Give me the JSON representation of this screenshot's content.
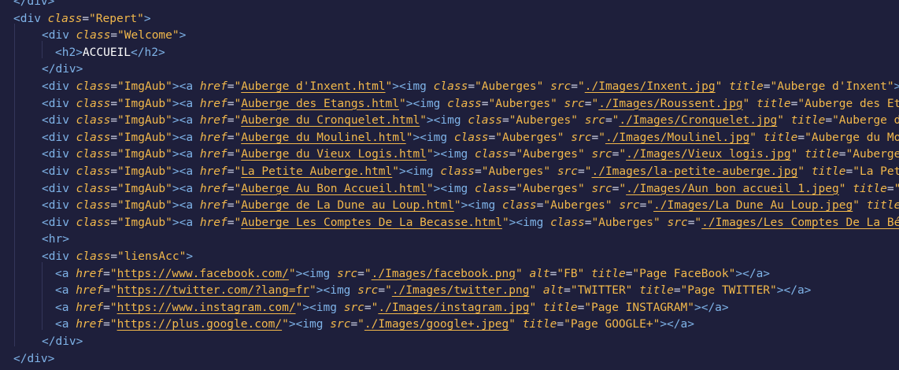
{
  "editor": {
    "colors": {
      "background": "#1e1f3b",
      "tag": "#7fb3e8",
      "attribute": "#f2b84b",
      "string": "#f2b84b",
      "text": "#ffffff"
    },
    "lines": [
      [
        [
          "t",
          "</div>"
        ]
      ],
      [
        [
          "t",
          "<div "
        ],
        [
          "a",
          "class"
        ],
        [
          "e",
          "="
        ],
        [
          "s",
          "\"Repert\""
        ],
        [
          "t",
          ">"
        ]
      ],
      [
        [
          "t",
          "<div "
        ],
        [
          "a",
          "class"
        ],
        [
          "e",
          "="
        ],
        [
          "s",
          "\"Welcome\""
        ],
        [
          "t",
          ">"
        ]
      ],
      [
        [
          "t",
          "<h2>"
        ],
        [
          "x",
          "ACCUEIL"
        ],
        [
          "t",
          "</h2>"
        ]
      ],
      [
        [
          "t",
          "</div>"
        ]
      ],
      [
        [
          "t",
          "<div "
        ],
        [
          "a",
          "class"
        ],
        [
          "e",
          "="
        ],
        [
          "s",
          "\"ImgAub\""
        ],
        [
          "t",
          "><a "
        ],
        [
          "a",
          "href"
        ],
        [
          "e",
          "="
        ],
        [
          "s",
          "\""
        ],
        [
          "l",
          "Auberge d'Inxent.html"
        ],
        [
          "s",
          "\""
        ],
        [
          "t",
          "><img "
        ],
        [
          "a",
          "class"
        ],
        [
          "e",
          "="
        ],
        [
          "s",
          "\"Auberges\" "
        ],
        [
          "a",
          "src"
        ],
        [
          "e",
          "="
        ],
        [
          "s",
          "\""
        ],
        [
          "l",
          "./Images/Inxent.jpg"
        ],
        [
          "s",
          "\" "
        ],
        [
          "a",
          "title"
        ],
        [
          "e",
          "="
        ],
        [
          "s",
          "\"Auberge d'Inxent\""
        ],
        [
          "t",
          "><"
        ]
      ],
      [
        [
          "t",
          "<div "
        ],
        [
          "a",
          "class"
        ],
        [
          "e",
          "="
        ],
        [
          "s",
          "\"ImgAub\""
        ],
        [
          "t",
          "><a "
        ],
        [
          "a",
          "href"
        ],
        [
          "e",
          "="
        ],
        [
          "s",
          "\""
        ],
        [
          "l",
          "Auberge des Etangs.html"
        ],
        [
          "s",
          "\""
        ],
        [
          "t",
          "><img "
        ],
        [
          "a",
          "class"
        ],
        [
          "e",
          "="
        ],
        [
          "s",
          "\"Auberges\" "
        ],
        [
          "a",
          "src"
        ],
        [
          "e",
          "="
        ],
        [
          "s",
          "\""
        ],
        [
          "l",
          "./Images/Roussent.jpg"
        ],
        [
          "s",
          "\" "
        ],
        [
          "a",
          "title"
        ],
        [
          "e",
          "="
        ],
        [
          "s",
          "\"Auberge des Etan"
        ]
      ],
      [
        [
          "t",
          "<div "
        ],
        [
          "a",
          "class"
        ],
        [
          "e",
          "="
        ],
        [
          "s",
          "\"ImgAub\""
        ],
        [
          "t",
          "><a "
        ],
        [
          "a",
          "href"
        ],
        [
          "e",
          "="
        ],
        [
          "s",
          "\""
        ],
        [
          "l",
          "Auberge du Cronquelet.html"
        ],
        [
          "s",
          "\""
        ],
        [
          "t",
          "><img "
        ],
        [
          "a",
          "class"
        ],
        [
          "e",
          "="
        ],
        [
          "s",
          "\"Auberges\" "
        ],
        [
          "a",
          "src"
        ],
        [
          "e",
          "="
        ],
        [
          "s",
          "\""
        ],
        [
          "l",
          "./Images/Cronquelet.jpg"
        ],
        [
          "s",
          "\" "
        ],
        [
          "a",
          "title"
        ],
        [
          "e",
          "="
        ],
        [
          "s",
          "\"Auberge du"
        ]
      ],
      [
        [
          "t",
          "<div "
        ],
        [
          "a",
          "class"
        ],
        [
          "e",
          "="
        ],
        [
          "s",
          "\"ImgAub\""
        ],
        [
          "t",
          "><a "
        ],
        [
          "a",
          "href"
        ],
        [
          "e",
          "="
        ],
        [
          "s",
          "\""
        ],
        [
          "l",
          "Auberge du Moulinel.html"
        ],
        [
          "s",
          "\""
        ],
        [
          "t",
          "><img "
        ],
        [
          "a",
          "class"
        ],
        [
          "e",
          "="
        ],
        [
          "s",
          "\"Auberges\" "
        ],
        [
          "a",
          "src"
        ],
        [
          "e",
          "="
        ],
        [
          "s",
          "\""
        ],
        [
          "l",
          "./Images/Moulinel.jpg"
        ],
        [
          "s",
          "\" "
        ],
        [
          "a",
          "title"
        ],
        [
          "e",
          "="
        ],
        [
          "s",
          "\"Auberge du Mou"
        ]
      ],
      [
        [
          "t",
          "<div "
        ],
        [
          "a",
          "class"
        ],
        [
          "e",
          "="
        ],
        [
          "s",
          "\"ImgAub\""
        ],
        [
          "t",
          "><a "
        ],
        [
          "a",
          "href"
        ],
        [
          "e",
          "="
        ],
        [
          "s",
          "\""
        ],
        [
          "l",
          "Auberge du Vieux Logis.html"
        ],
        [
          "s",
          "\""
        ],
        [
          "t",
          "><img "
        ],
        [
          "a",
          "class"
        ],
        [
          "e",
          "="
        ],
        [
          "s",
          "\"Auberges\" "
        ],
        [
          "a",
          "src"
        ],
        [
          "e",
          "="
        ],
        [
          "s",
          "\""
        ],
        [
          "l",
          "./Images/Vieux logis.jpg"
        ],
        [
          "s",
          "\" "
        ],
        [
          "a",
          "title"
        ],
        [
          "e",
          "="
        ],
        [
          "s",
          "\"Auberge "
        ]
      ],
      [
        [
          "t",
          "<div "
        ],
        [
          "a",
          "class"
        ],
        [
          "e",
          "="
        ],
        [
          "s",
          "\"ImgAub\""
        ],
        [
          "t",
          "><a "
        ],
        [
          "a",
          "href"
        ],
        [
          "e",
          "="
        ],
        [
          "s",
          "\""
        ],
        [
          "l",
          "La Petite Auberge.html"
        ],
        [
          "s",
          "\""
        ],
        [
          "t",
          "><img "
        ],
        [
          "a",
          "class"
        ],
        [
          "e",
          "="
        ],
        [
          "s",
          "\"Auberges\" "
        ],
        [
          "a",
          "src"
        ],
        [
          "e",
          "="
        ],
        [
          "s",
          "\""
        ],
        [
          "l",
          "./Images/la-petite-auberge.jpg"
        ],
        [
          "s",
          "\" "
        ],
        [
          "a",
          "title"
        ],
        [
          "e",
          "="
        ],
        [
          "s",
          "\"La Peti"
        ]
      ],
      [
        [
          "t",
          "<div "
        ],
        [
          "a",
          "class"
        ],
        [
          "e",
          "="
        ],
        [
          "s",
          "\"ImgAub\""
        ],
        [
          "t",
          "><a "
        ],
        [
          "a",
          "href"
        ],
        [
          "e",
          "="
        ],
        [
          "s",
          "\""
        ],
        [
          "l",
          "Auberge Au Bon Accueil.html"
        ],
        [
          "s",
          "\""
        ],
        [
          "t",
          "><img "
        ],
        [
          "a",
          "class"
        ],
        [
          "e",
          "="
        ],
        [
          "s",
          "\"Auberges\" "
        ],
        [
          "a",
          "src"
        ],
        [
          "e",
          "="
        ],
        [
          "s",
          "\""
        ],
        [
          "l",
          "./Images/Aun bon accueil 1.jpeg"
        ],
        [
          "s",
          "\" "
        ],
        [
          "a",
          "title"
        ],
        [
          "e",
          "="
        ],
        [
          "s",
          "\"A"
        ]
      ],
      [
        [
          "t",
          "<div "
        ],
        [
          "a",
          "class"
        ],
        [
          "e",
          "="
        ],
        [
          "s",
          "\"ImgAub\""
        ],
        [
          "t",
          "><a "
        ],
        [
          "a",
          "href"
        ],
        [
          "e",
          "="
        ],
        [
          "s",
          "\""
        ],
        [
          "l",
          "Auberge de La Dune au Loup.html"
        ],
        [
          "s",
          "\""
        ],
        [
          "t",
          "><img "
        ],
        [
          "a",
          "class"
        ],
        [
          "e",
          "="
        ],
        [
          "s",
          "\"Auberges\" "
        ],
        [
          "a",
          "src"
        ],
        [
          "e",
          "="
        ],
        [
          "s",
          "\""
        ],
        [
          "l",
          "./Images/La Dune Au Loup.jpeg"
        ],
        [
          "s",
          "\" "
        ],
        [
          "a",
          "title"
        ],
        [
          "e",
          "="
        ]
      ],
      [
        [
          "t",
          "<div "
        ],
        [
          "a",
          "class"
        ],
        [
          "e",
          "="
        ],
        [
          "s",
          "\"ImgAub\""
        ],
        [
          "t",
          "><a "
        ],
        [
          "a",
          "href"
        ],
        [
          "e",
          "="
        ],
        [
          "s",
          "\""
        ],
        [
          "l",
          "Auberge Les Comptes De La Becasse.html"
        ],
        [
          "s",
          "\""
        ],
        [
          "t",
          "><img "
        ],
        [
          "a",
          "class"
        ],
        [
          "e",
          "="
        ],
        [
          "s",
          "\"Auberges\" "
        ],
        [
          "a",
          "src"
        ],
        [
          "e",
          "="
        ],
        [
          "s",
          "\""
        ],
        [
          "l",
          "./Images/Les Comptes De La Bé"
        ]
      ],
      [
        [
          "t",
          "<hr>"
        ]
      ],
      [
        [
          "t",
          "<div "
        ],
        [
          "a",
          "class"
        ],
        [
          "e",
          "="
        ],
        [
          "s",
          "\"liensAcc\""
        ],
        [
          "t",
          ">"
        ]
      ],
      [
        [
          "t",
          "<a "
        ],
        [
          "a",
          "href"
        ],
        [
          "e",
          "="
        ],
        [
          "s",
          "\""
        ],
        [
          "l",
          "https://www.facebook.com/"
        ],
        [
          "s",
          "\""
        ],
        [
          "t",
          "><img "
        ],
        [
          "a",
          "src"
        ],
        [
          "e",
          "="
        ],
        [
          "s",
          "\""
        ],
        [
          "l",
          "./Images/facebook.png"
        ],
        [
          "s",
          "\" "
        ],
        [
          "a",
          "alt"
        ],
        [
          "e",
          "="
        ],
        [
          "s",
          "\"FB\" "
        ],
        [
          "a",
          "title"
        ],
        [
          "e",
          "="
        ],
        [
          "s",
          "\"Page FaceBook\""
        ],
        [
          "t",
          "></a>"
        ]
      ],
      [
        [
          "t",
          "<a "
        ],
        [
          "a",
          "href"
        ],
        [
          "e",
          "="
        ],
        [
          "s",
          "\""
        ],
        [
          "l",
          "https://twitter.com/?lang=fr"
        ],
        [
          "s",
          "\""
        ],
        [
          "t",
          "><img "
        ],
        [
          "a",
          "src"
        ],
        [
          "e",
          "="
        ],
        [
          "s",
          "\""
        ],
        [
          "l",
          "./Images/twitter.png"
        ],
        [
          "s",
          "\" "
        ],
        [
          "a",
          "alt"
        ],
        [
          "e",
          "="
        ],
        [
          "s",
          "\"TWITTER\" "
        ],
        [
          "a",
          "title"
        ],
        [
          "e",
          "="
        ],
        [
          "s",
          "\"Page TWITTER\""
        ],
        [
          "t",
          "></a>"
        ]
      ],
      [
        [
          "t",
          "<a "
        ],
        [
          "a",
          "href"
        ],
        [
          "e",
          "="
        ],
        [
          "s",
          "\""
        ],
        [
          "l",
          "https://www.instagram.com/"
        ],
        [
          "s",
          "\""
        ],
        [
          "t",
          "><img "
        ],
        [
          "a",
          "src"
        ],
        [
          "e",
          "="
        ],
        [
          "s",
          "\""
        ],
        [
          "l",
          "./Images/instagram.jpg"
        ],
        [
          "s",
          "\" "
        ],
        [
          "a",
          "title"
        ],
        [
          "e",
          "="
        ],
        [
          "s",
          "\"Page INSTAGRAM\""
        ],
        [
          "t",
          "></a>"
        ]
      ],
      [
        [
          "t",
          "<a "
        ],
        [
          "a",
          "href"
        ],
        [
          "e",
          "="
        ],
        [
          "s",
          "\""
        ],
        [
          "l",
          "https://plus.google.com/"
        ],
        [
          "s",
          "\""
        ],
        [
          "t",
          "><img "
        ],
        [
          "a",
          "src"
        ],
        [
          "e",
          "="
        ],
        [
          "s",
          "\""
        ],
        [
          "l",
          "./Images/google+.jpeg"
        ],
        [
          "s",
          "\" "
        ],
        [
          "a",
          "title"
        ],
        [
          "e",
          "="
        ],
        [
          "s",
          "\"Page GOOGLE+\""
        ],
        [
          "t",
          "></a>"
        ]
      ],
      [
        [
          "t",
          "</div>"
        ]
      ],
      [
        [
          "t",
          "</div>"
        ]
      ],
      [
        [
          "t",
          "<"
        ]
      ]
    ]
  }
}
